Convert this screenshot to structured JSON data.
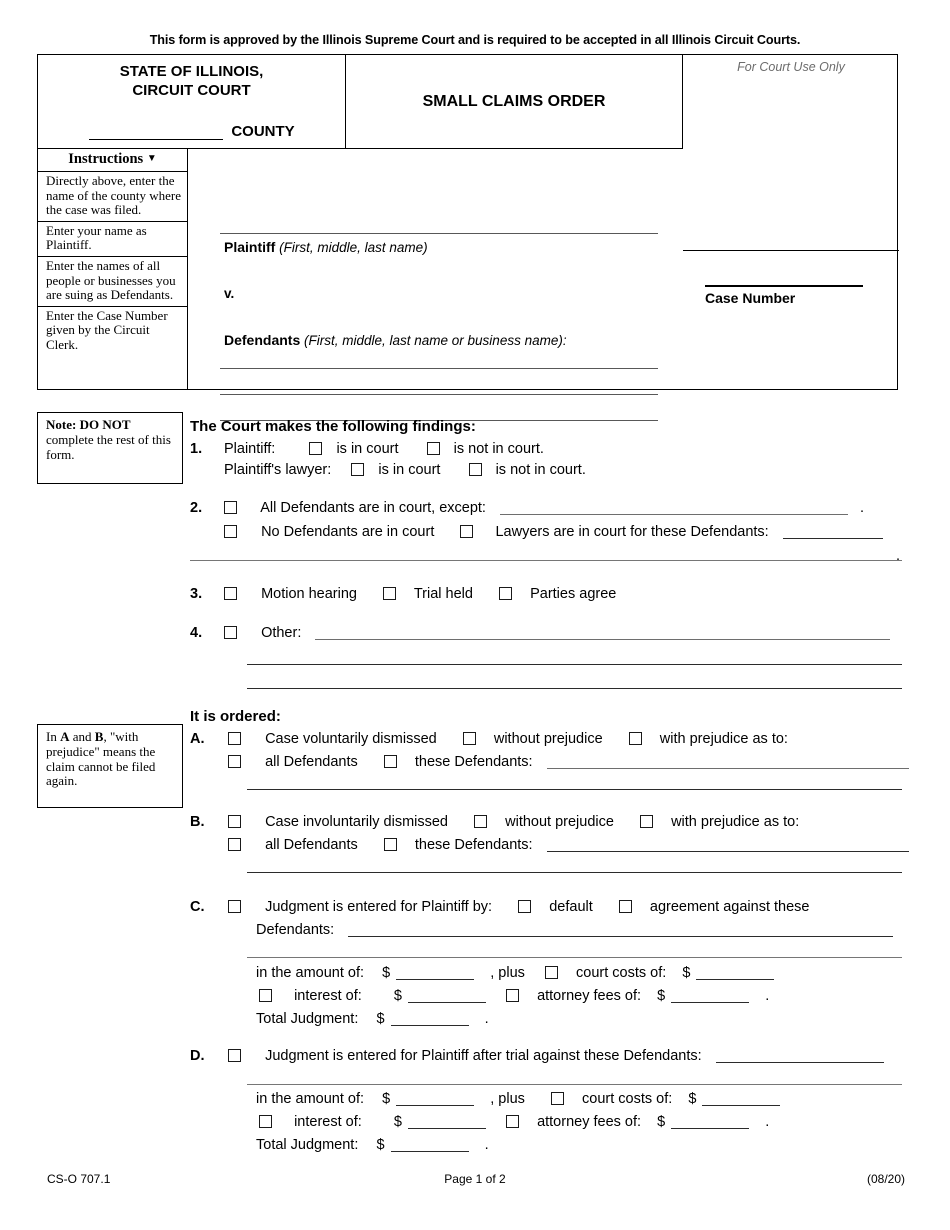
{
  "approval_note": "This form is approved by the Illinois Supreme Court and is required to be accepted in all Illinois Circuit Courts.",
  "caption": {
    "state_line1": "STATE OF ILLINOIS,",
    "state_line2": "CIRCUIT COURT",
    "county_label": "COUNTY",
    "form_title": "SMALL CLAIMS ORDER",
    "court_use_only": "For Court Use Only",
    "case_number_label": "Case Number"
  },
  "instructions": {
    "header": "Instructions",
    "caret": "▼",
    "items": [
      "Directly above, enter the name of the county where the case was filed.",
      "Enter your name as Plaintiff.",
      "Enter the names of all people or businesses you are suing as Defendants.",
      "Enter the Case Number given by the Circuit Clerk."
    ]
  },
  "party": {
    "plaintiff_label": "Plaintiff",
    "plaintiff_hint": "(First, middle, last name)",
    "versus": "v.",
    "defendants_label": "Defendants",
    "defendants_hint": "(First, middle, last name or business name):"
  },
  "notes": {
    "do_not_title": "Note: DO NOT",
    "do_not_body": "complete the rest of this form.",
    "prejudice_pre": "In ",
    "prejudice_a": "A",
    "prejudice_and": " and ",
    "prejudice_b": "B",
    "prejudice_body": ", \"with prejudice\" means the claim cannot be filed again."
  },
  "findings": {
    "heading": "The Court makes the following findings:",
    "item1": {
      "num": "1.",
      "plaintiff_label": "Plaintiff:",
      "opt_in_court": "is in court",
      "opt_not_in_court": "is not in court.",
      "lawyer_label": "Plaintiff's lawyer:",
      "lawyer_in_court": "is in court",
      "lawyer_not_in_court": "is not in court."
    },
    "item2": {
      "num": "2.",
      "all_defendants": "All Defendants are in court, except:",
      "period": ".",
      "no_defendants": "No Defendants are in court",
      "lawyers_for": "Lawyers are in court for these Defendants:"
    },
    "item3": {
      "num": "3.",
      "motion_hearing": "Motion hearing",
      "trial_held": "Trial held",
      "parties_agree": "Parties agree"
    },
    "item4": {
      "num": "4.",
      "other": "Other:"
    }
  },
  "ordered": {
    "heading": "It is ordered:",
    "a": {
      "letter": "A.",
      "main": "Case voluntarily dismissed",
      "without_prejudice": "without prejudice",
      "with_prejudice": "with prejudice as to:",
      "all_defendants": "all Defendants",
      "these_defendants": "these Defendants:"
    },
    "b": {
      "letter": "B.",
      "main": "Case involuntarily dismissed",
      "without_prejudice": "without prejudice",
      "with_prejudice": "with prejudice as to:",
      "all_defendants": "all Defendants",
      "these_defendants": "these Defendants:"
    },
    "c": {
      "letter": "C.",
      "main": "Judgment is entered for Plaintiff by:",
      "default": "default",
      "agreement": "agreement against these",
      "defendants": "Defendants:",
      "amount_label": "in the amount of:",
      "dollar": "$",
      "plus": ", plus",
      "court_costs": "court costs of:",
      "interest": "interest of:",
      "attorney_fees": "attorney fees of:",
      "period": ".",
      "total": "Total Judgment:"
    },
    "d": {
      "letter": "D.",
      "main": "Judgment is entered for Plaintiff after trial against these Defendants:",
      "amount_label": "in the amount of:",
      "dollar": "$",
      "plus": ", plus",
      "court_costs": "court costs of:",
      "interest": "interest of:",
      "attorney_fees": "attorney fees of:",
      "period": ".",
      "total": "Total Judgment:"
    }
  },
  "footer": {
    "form_code": "CS-O 707.1",
    "page": "Page 1 of 2",
    "revision": "(08/20)"
  }
}
